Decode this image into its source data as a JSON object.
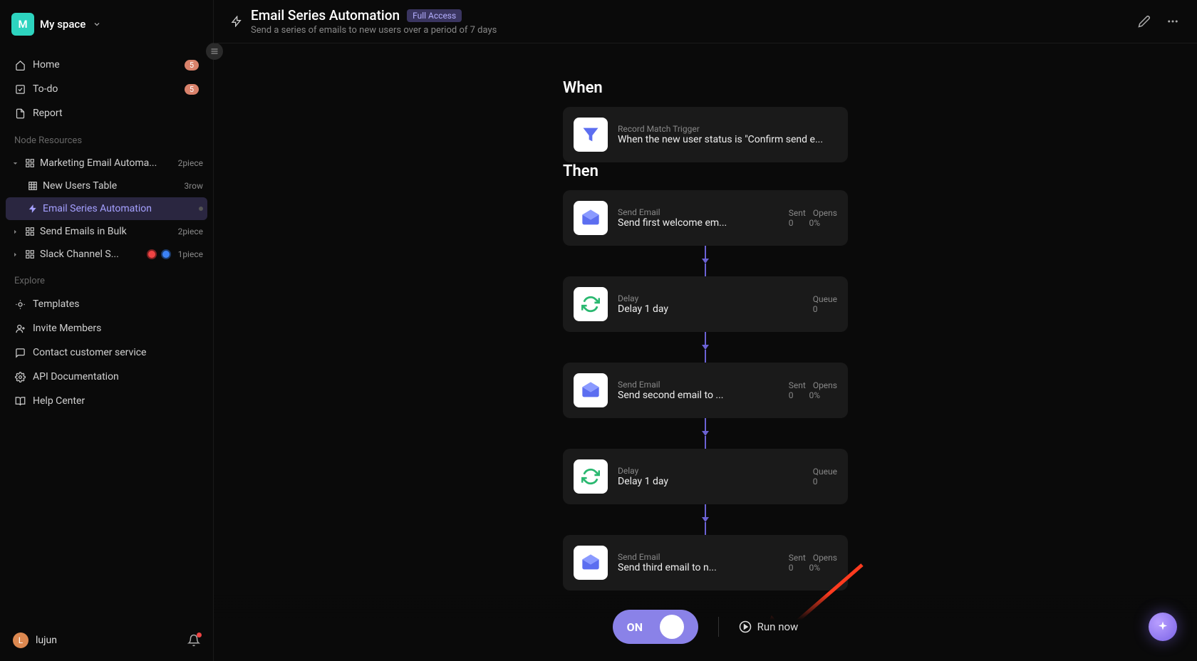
{
  "workspace": {
    "avatar_letter": "M",
    "name": "My space"
  },
  "sidebar": {
    "home": {
      "label": "Home",
      "badge": "5"
    },
    "todo": {
      "label": "To-do",
      "badge": "5"
    },
    "report": {
      "label": "Report"
    },
    "section_resources": "Node Resources",
    "tree": {
      "marketing": {
        "name": "Marketing Email Automa...",
        "meta": "2piece"
      },
      "new_users": {
        "name": "New Users Table",
        "meta": "3row"
      },
      "email_series": {
        "name": "Email Series Automation"
      },
      "send_bulk": {
        "name": "Send Emails in Bulk",
        "meta": "2piece"
      },
      "slack": {
        "name": "Slack Channel S...",
        "meta": "1piece"
      }
    },
    "section_explore": "Explore",
    "explore": {
      "templates": "Templates",
      "invite": "Invite Members",
      "contact": "Contact customer service",
      "api": "API Documentation",
      "help": "Help Center"
    }
  },
  "user": {
    "avatar_letter": "L",
    "name": "lujun"
  },
  "header": {
    "title": "Email Series Automation",
    "access": "Full Access",
    "description": "Send a series of emails to new users over a period of 7 days"
  },
  "flow": {
    "when_heading": "When",
    "then_heading": "Then",
    "trigger": {
      "type": "Record Match Trigger",
      "title": "When the new user status is \"Confirm send e..."
    },
    "steps": [
      {
        "kind": "email",
        "type": "Send Email",
        "title": "Send first welcome em...",
        "stat1_label": "Sent",
        "stat2_label": "Opens",
        "stat1": "0",
        "stat2": "0%"
      },
      {
        "kind": "delay",
        "type": "Delay",
        "title": "Delay 1 day",
        "stat1_label": "Queue",
        "stat1": "0"
      },
      {
        "kind": "email",
        "type": "Send Email",
        "title": "Send second email to ...",
        "stat1_label": "Sent",
        "stat2_label": "Opens",
        "stat1": "0",
        "stat2": "0%"
      },
      {
        "kind": "delay",
        "type": "Delay",
        "title": "Delay 1 day",
        "stat1_label": "Queue",
        "stat1": "0"
      },
      {
        "kind": "email",
        "type": "Send Email",
        "title": "Send third email to n...",
        "stat1_label": "Sent",
        "stat2_label": "Opens",
        "stat1": "0",
        "stat2": "0%"
      }
    ]
  },
  "controls": {
    "toggle_label": "ON",
    "run_now": "Run now"
  }
}
